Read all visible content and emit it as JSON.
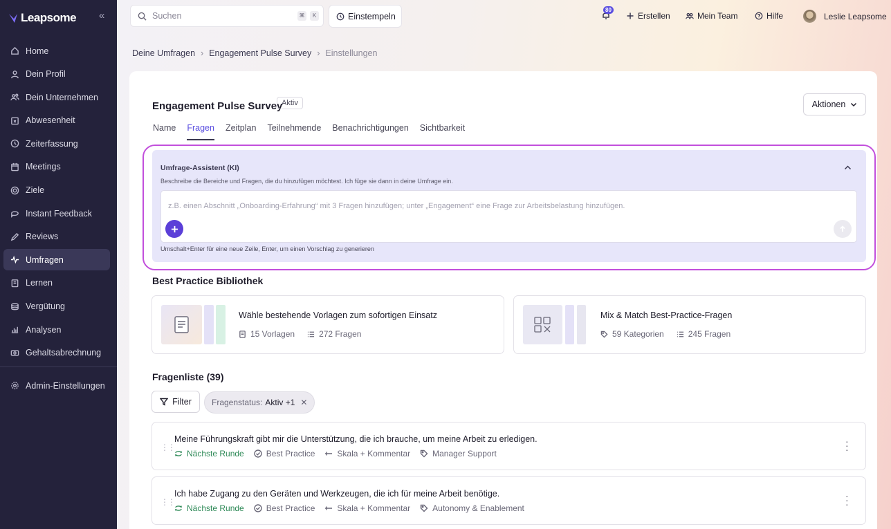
{
  "app": {
    "name": "Leapsome"
  },
  "sidebar": {
    "items": [
      {
        "label": "Home",
        "icon": "home-icon"
      },
      {
        "label": "Dein Profil",
        "icon": "user-icon"
      },
      {
        "label": "Dein Unternehmen",
        "icon": "users-icon"
      },
      {
        "label": "Abwesenheit",
        "icon": "calendar-x-icon"
      },
      {
        "label": "Zeiterfassung",
        "icon": "clock-icon"
      },
      {
        "label": "Meetings",
        "icon": "calendar-icon"
      },
      {
        "label": "Ziele",
        "icon": "target-icon"
      },
      {
        "label": "Instant Feedback",
        "icon": "message-icon"
      },
      {
        "label": "Reviews",
        "icon": "pencil-icon"
      },
      {
        "label": "Umfragen",
        "icon": "pulse-icon",
        "active": true
      },
      {
        "label": "Lernen",
        "icon": "book-icon"
      },
      {
        "label": "Vergütung",
        "icon": "coins-icon"
      },
      {
        "label": "Analysen",
        "icon": "chart-icon"
      },
      {
        "label": "Gehaltsabrechnung",
        "icon": "cash-icon"
      }
    ],
    "admin": {
      "label": "Admin-Einstellungen",
      "icon": "gear-icon"
    }
  },
  "topbar": {
    "search_placeholder": "Suchen",
    "shortcut_keys": [
      "⌘",
      "K"
    ],
    "clockin": "Einstempeln",
    "notifications_count": "80",
    "create": "Erstellen",
    "team": "Mein Team",
    "help": "Hilfe",
    "user": "Leslie Leapsome"
  },
  "breadcrumb": [
    "Deine Umfragen",
    "Engagement Pulse Survey",
    "Einstellungen"
  ],
  "survey": {
    "title": "Engagement Pulse Survey",
    "status": "Aktiv",
    "actions": "Aktionen",
    "tabs": [
      "Name",
      "Fragen",
      "Zeitplan",
      "Teilnehmende",
      "Benachrichtigungen",
      "Sichtbarkeit"
    ],
    "active_tab": "Fragen"
  },
  "assistant": {
    "title": "Umfrage-Assistent (KI)",
    "description": "Beschreibe die Bereiche und Fragen, die du hinzufügen möchtest. Ich füge sie dann in deine Umfrage ein.",
    "placeholder": "z.B. einen Abschnitt „Onboarding-Erfahrung“ mit 3 Fragen hinzufügen; unter „Engagement“ eine Frage zur Arbeitsbelastung hinzufügen.",
    "hint": "Umschalt+Enter für eine neue Zeile, Enter, um einen Vorschlag zu generieren"
  },
  "library": {
    "heading": "Best Practice Bibliothek",
    "cards": [
      {
        "title": "Wähle bestehende Vorlagen zum sofortigen Einsatz",
        "meta1": "15 Vorlagen",
        "meta2": "272 Fragen"
      },
      {
        "title": "Mix & Match Best-Practice-Fragen",
        "meta1": "59 Kategorien",
        "meta2": "245 Fragen"
      }
    ]
  },
  "questions": {
    "heading": "Fragenliste (39)",
    "filter": "Filter",
    "chip_label": "Fragenstatus:",
    "chip_value": "Aktiv +1",
    "items": [
      {
        "text": "Meine Führungskraft gibt mir die Unterstützung, die ich brauche, um meine Arbeit zu erledigen.",
        "round": "Nächste Runde",
        "type": "Best Practice",
        "format": "Skala + Kommentar",
        "tag": "Manager Support"
      },
      {
        "text": "Ich habe Zugang zu den Geräten und Werkzeugen, die ich für meine Arbeit benötige.",
        "round": "Nächste Runde",
        "type": "Best Practice",
        "format": "Skala + Kommentar",
        "tag": "Autonomy & Enablement"
      }
    ]
  },
  "colors": {
    "sidebar": "#24223b",
    "accent": "#5b4fe0",
    "ai_outline": "#c24fdc",
    "green": "#2f8a58"
  }
}
